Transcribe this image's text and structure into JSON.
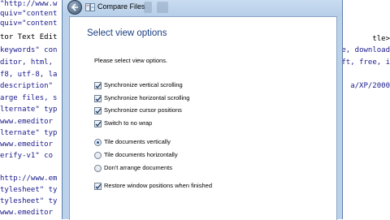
{
  "background_editor": {
    "left_lines": [
      "\"http://www.w",
      "quiv=\"content",
      "quiv=\"content",
      "tor Text Edit",
      "keywords\" con",
      "ditor, html,",
      "f8, utf-8, la",
      "description\" ",
      "arge files, s",
      "lternate\" typ",
      "www.emeditor",
      "lternate\" typ",
      "www.emeditor",
      "erify-v1\" co",
      "",
      "http://www.em",
      "tylesheet\" ty",
      "tylesheet\" ty",
      "www.emeditor"
    ],
    "right_lines": [
      "tle>",
      "e, download",
      "ft, free, i",
      "",
      "a/XP/2000",
      "",
      "",
      "",
      "",
      "",
      ""
    ]
  },
  "window": {
    "title": "Compare Files",
    "back_button": "back-arrow"
  },
  "dialog": {
    "heading": "Select view options",
    "prompt": "Please select view options.",
    "checkboxes": [
      {
        "label": "Synchronize vertical scrolling",
        "checked": true
      },
      {
        "label": "Synchronize horizontal scrolling",
        "checked": true
      },
      {
        "label": "Synchronize cursor positions",
        "checked": true
      },
      {
        "label": "Switch to no wrap",
        "checked": true
      }
    ],
    "radios": [
      {
        "label": "Tile documents vertically",
        "selected": true
      },
      {
        "label": "Tile documents horizontally",
        "selected": false
      },
      {
        "label": "Don't arrange documents",
        "selected": false
      }
    ],
    "restore": {
      "label": "Restore window positions when finished",
      "checked": true
    }
  },
  "colors": {
    "heading": "#1b3f83",
    "frame": "#bcd2ea",
    "editor_text": "#1a1a8c"
  }
}
